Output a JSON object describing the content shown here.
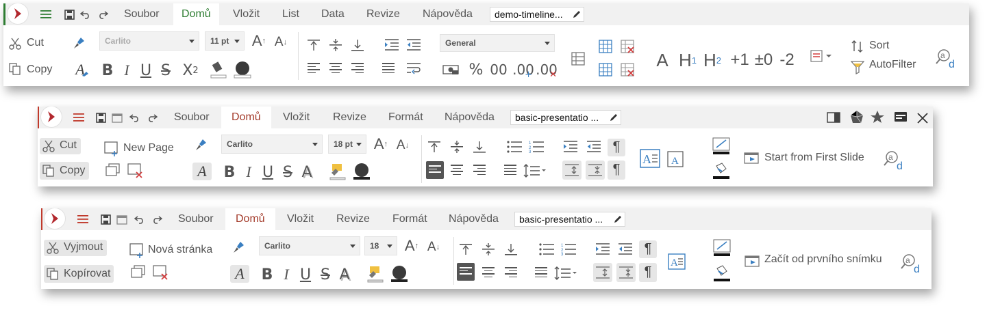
{
  "toolbar1": {
    "tabs": [
      "Soubor",
      "Domů",
      "Vložit",
      "List",
      "Data",
      "Revize",
      "Nápověda"
    ],
    "doc_name": "demo-timeline...",
    "cut": "Cut",
    "copy": "Copy",
    "font_name": "Carlito",
    "font_size": "11 pt",
    "number_format": "General",
    "percent": "%",
    "fmt_00": "00",
    "fmt_add": ".00",
    "fmt_del": ".00",
    "style_a": "A",
    "style_h1": "H",
    "style_h1_sub": "1",
    "style_h2": "H",
    "style_h2_sub": "2",
    "style_plus1": "+1",
    "style_pm0": "±0",
    "style_minus2": "-2",
    "sort": "Sort",
    "autofilter": "AutoFilter",
    "superscript": "X",
    "superscript_sup": "2"
  },
  "toolbar2": {
    "tabs": [
      "Soubor",
      "Domů",
      "Vložit",
      "Revize",
      "Formát",
      "Nápověda"
    ],
    "doc_name": "basic-presentatio  ...",
    "cut": "Cut",
    "copy": "Copy",
    "new_page": "New Page",
    "font_name": "Carlito",
    "font_size": "18 pt",
    "start_slideshow": "Start from First Slide"
  },
  "toolbar3": {
    "tabs": [
      "Soubor",
      "Domů",
      "Vložit",
      "Revize",
      "Formát",
      "Nápověda"
    ],
    "doc_name": "basic-presentatio  ...",
    "cut": "Vyjmout",
    "copy": "Kopírovat",
    "new_page": "Nová stránka",
    "font_name": "Carlito",
    "font_size": "18",
    "start_slideshow": "Začít od prvního snímku"
  },
  "common": {
    "bold": "B",
    "italic": "I",
    "underline": "U",
    "strike": "S",
    "shadow": "A",
    "grow": "A",
    "shrink": "A"
  },
  "colors": {
    "accent_green": "#2e7d32",
    "accent_red": "#a33a2a",
    "logo_red": "#b2282e",
    "icon_blue": "#3a7fc1",
    "icon_red": "#d23c3c"
  },
  "icons": [
    "menu-icon",
    "save-icon",
    "undo-icon",
    "redo-icon",
    "pencil-icon",
    "scissors-icon",
    "copy-icon",
    "paintbrush-icon",
    "clear-format-icon",
    "fill-color-icon",
    "cell-background-icon",
    "align-icons",
    "indent-icons",
    "currency-icon",
    "insert-row-icon",
    "delete-row-icon",
    "conditional-format-icon",
    "sort-icon",
    "autofilter-icon",
    "find-replace-icon",
    "sidebar-icon",
    "shapes-icon",
    "star-icon",
    "notebookbar-icon",
    "close-icon",
    "slideshow-icon"
  ]
}
